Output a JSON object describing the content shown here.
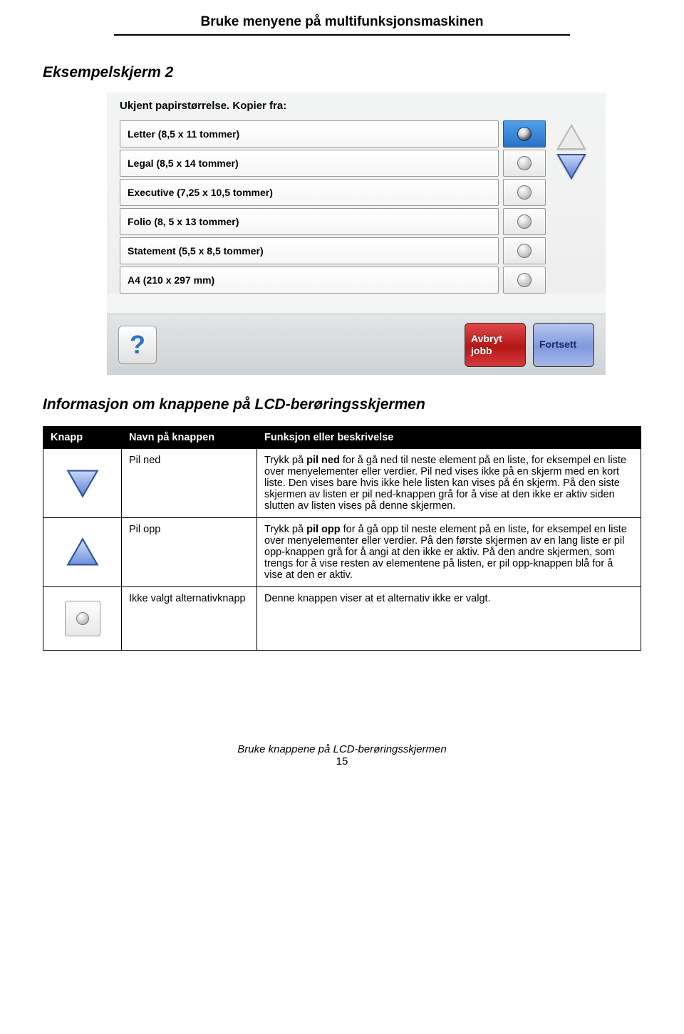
{
  "doc": {
    "title": "Bruke menyene på multifunksjonsmaskinen",
    "section_heading": "Eksempelskjerm 2",
    "info_heading": "Informasjon om knappene på LCD-berøringsskjermen",
    "footer_line": "Bruke knappene på LCD-berøringsskjermen",
    "page_number": "15"
  },
  "panel": {
    "heading": "Ukjent papirstørrelse. Kopier fra:",
    "options": [
      "Letter (8,5 x 11 tommer)",
      "Legal (8,5 x 14 tommer)",
      "Executive (7,25 x 10,5 tommer)",
      "Folio (8, 5 x 13 tommer)",
      "Statement (5,5 x 8,5 tommer)",
      "A4 (210 x 297 mm)"
    ],
    "selected_index": 0,
    "cancel_label": "Avbryt jobb",
    "continue_label": "Fortsett"
  },
  "table": {
    "headers": {
      "button": "Knapp",
      "name": "Navn på knappen",
      "desc": "Funksjon eller beskrivelse"
    },
    "rows": [
      {
        "name": "Pil ned",
        "desc_pre": "Trykk på ",
        "desc_bold": "pil ned",
        "desc_post": " for å gå ned til neste element på en liste, for eksempel en liste over menyelementer eller verdier. Pil ned vises ikke på en skjerm med en kort liste. Den vises bare hvis ikke hele listen kan vises på én skjerm. På den siste skjermen av listen er pil ned-knappen grå for å vise at den ikke er aktiv siden slutten av listen vises på denne skjermen."
      },
      {
        "name": "Pil opp",
        "desc_pre": "Trykk på ",
        "desc_bold": "pil opp",
        "desc_post": " for å gå opp til neste element på en liste, for eksempel en liste over menyelementer eller verdier. På den første skjermen av en lang liste er pil opp-knappen grå for å angi at den ikke er aktiv. På den andre skjermen, som trengs for å vise resten av elementene på listen, er pil opp-knappen blå for å vise at den er aktiv."
      },
      {
        "name": "Ikke valgt alternativknapp",
        "desc_full": "Denne knappen viser at et alternativ ikke er valgt."
      }
    ]
  }
}
